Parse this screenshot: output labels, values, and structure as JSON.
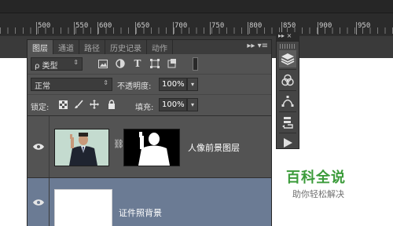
{
  "ruler": {
    "marks": [
      "500",
      "550",
      "600",
      "650",
      "700",
      "750",
      "800",
      "850",
      "900",
      "950"
    ]
  },
  "layers_panel": {
    "tabs": [
      {
        "label": "图层",
        "active": true
      },
      {
        "label": "通道",
        "active": false
      },
      {
        "label": "路径",
        "active": false
      },
      {
        "label": "历史记录",
        "active": false
      },
      {
        "label": "动作",
        "active": false
      }
    ],
    "menu_label": "▸▸  ▾≡",
    "filter": {
      "label": "ρ 类型"
    },
    "blend_mode": {
      "value": "正常"
    },
    "opacity": {
      "label": "不透明度:",
      "value": "100%"
    },
    "lock": {
      "label": "锁定:"
    },
    "fill": {
      "label": "填充:",
      "value": "100%"
    },
    "layers": [
      {
        "name": "人像前景图层",
        "visible": true,
        "has_mask": true
      },
      {
        "name": "证件照背景",
        "visible": true,
        "has_mask": false,
        "selected": true
      }
    ]
  },
  "side_panel": {
    "header": "▸▸  ×",
    "buttons": [
      "layers-icon",
      "channels-icon",
      "paths-icon",
      "history-icon",
      "actions-icon"
    ]
  },
  "watermark": {
    "title": "百科全说",
    "subtitle": "助你轻松解决"
  },
  "colors": {
    "panel_bg": "#535353",
    "selected_layer": "#6b7b94",
    "watermark_green": "#3b9b3a"
  }
}
